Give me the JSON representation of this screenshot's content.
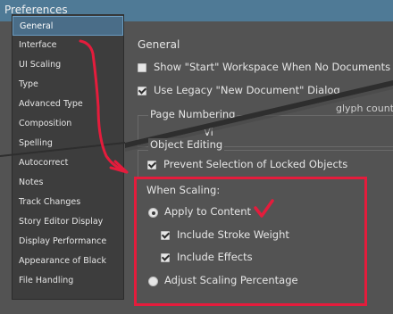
{
  "window": {
    "title": "Preferences"
  },
  "sidebar": {
    "items": [
      {
        "label": "General",
        "selected": true
      },
      {
        "label": "Interface"
      },
      {
        "label": "UI Scaling"
      },
      {
        "label": "Type"
      },
      {
        "label": "Advanced Type"
      },
      {
        "label": "Composition"
      },
      {
        "label": "Spelling"
      },
      {
        "label": "Autocorrect"
      },
      {
        "label": "Notes"
      },
      {
        "label": "Track Changes"
      },
      {
        "label": "Story Editor Display"
      },
      {
        "label": "Display Performance"
      },
      {
        "label": "Appearance of Black"
      },
      {
        "label": "File Handling"
      }
    ]
  },
  "general": {
    "title": "General",
    "show_start": {
      "label": "Show \"Start\" Workspace When No Documents A",
      "checked": false
    },
    "legacy_dialog": {
      "label": "Use Legacy \"New Document\" Dialog",
      "checked": true
    },
    "page_numbering_title": "Page Numbering",
    "page_numbering_view_fragment": "Vi",
    "glyph_fragment": "glyph counts gi"
  },
  "object_editing": {
    "title": "Object Editing",
    "prevent_selection": {
      "label": "Prevent Selection of Locked Objects",
      "checked": true
    }
  },
  "scaling": {
    "title": "When Scaling:",
    "apply_to_content": {
      "label": "Apply to Content",
      "selected": true
    },
    "include_stroke": {
      "label": "Include Stroke Weight",
      "checked": true
    },
    "include_effects": {
      "label": "Include Effects",
      "checked": true
    },
    "adjust_percentage": {
      "label": "Adjust Scaling Percentage",
      "selected": false
    }
  },
  "annotation": {
    "highlight_color": "#e41c3c"
  }
}
